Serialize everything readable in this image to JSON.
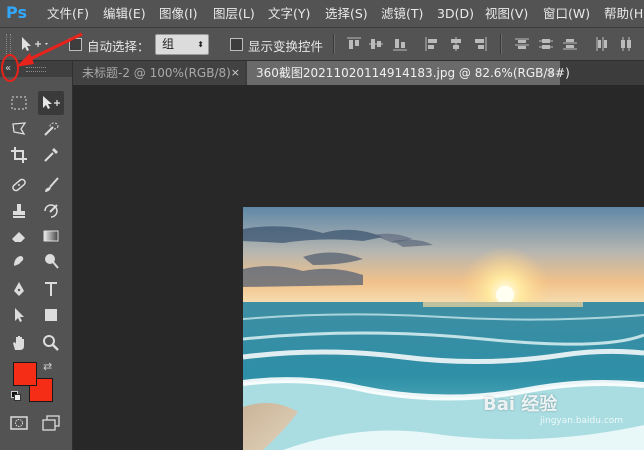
{
  "app": {
    "logo": "Ps"
  },
  "menu": {
    "items": [
      "文件(F)",
      "编辑(E)",
      "图像(I)",
      "图层(L)",
      "文字(Y)",
      "选择(S)",
      "滤镜(T)",
      "3D(D)",
      "视图(V)",
      "窗口(W)",
      "帮助(H)"
    ]
  },
  "options": {
    "auto_select_label": "自动选择：",
    "auto_select_value": "组",
    "show_transform_label": "显示变换控件"
  },
  "tabs": [
    {
      "title": "未标题-2 @ 100%(RGB/8)",
      "close": "×",
      "active": false
    },
    {
      "title": "360截图20211020114914183.jpg @ 82.6%(RGB/8#)",
      "close": "×",
      "active": true
    }
  ],
  "colors": {
    "foreground": "#f52d16",
    "background": "#f52d16",
    "annotation": "#e8231b"
  },
  "canvas": {
    "watermark": "Bai 经验",
    "watermark_sub": "jingyan.baidu.com"
  }
}
